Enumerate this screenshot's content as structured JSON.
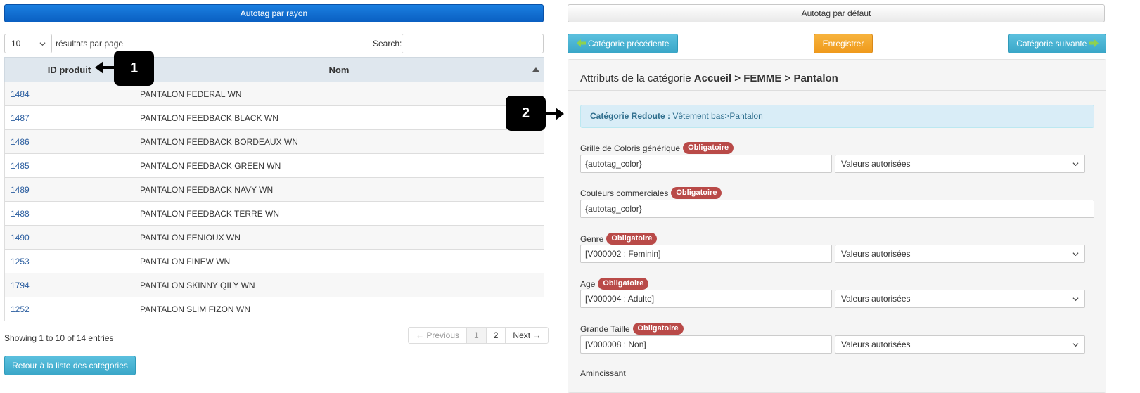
{
  "left": {
    "autotag_rayon_label": "Autotag par rayon",
    "per_page_value": "10",
    "per_page_label": "résultats par page",
    "search_label": "Search:",
    "search_value": "",
    "table": {
      "columns": [
        "ID produit",
        "Nom"
      ],
      "rows": [
        {
          "id": "1484",
          "nom": "PANTALON FEDERAL WN"
        },
        {
          "id": "1487",
          "nom": "PANTALON FEEDBACK BLACK WN"
        },
        {
          "id": "1486",
          "nom": "PANTALON FEEDBACK BORDEAUX WN"
        },
        {
          "id": "1485",
          "nom": "PANTALON FEEDBACK GREEN WN"
        },
        {
          "id": "1489",
          "nom": "PANTALON FEEDBACK NAVY WN"
        },
        {
          "id": "1488",
          "nom": "PANTALON FEEDBACK TERRE WN"
        },
        {
          "id": "1490",
          "nom": "PANTALON FENIOUX WN"
        },
        {
          "id": "1253",
          "nom": "PANTALON FINEW WN"
        },
        {
          "id": "1794",
          "nom": "PANTALON SKINNY QILY WN"
        },
        {
          "id": "1252",
          "nom": "PANTALON SLIM FIZON WN"
        }
      ]
    },
    "showing_text": "Showing 1 to 10 of 14 entries",
    "pagination": {
      "previous": "← Previous",
      "page1": "1",
      "page2": "2",
      "next": "Next →"
    },
    "retour_label": "Retour à la liste des catégories"
  },
  "right": {
    "autotag_defaut_label": "Autotag par défaut",
    "prev_category_label": "Catégorie précédente",
    "save_label": "Enregistrer",
    "next_category_label": "Catégorie suivante",
    "panel_title_prefix": "Attributs de la catégorie ",
    "panel_title_path": "Accueil > FEMME > Pantalon",
    "info_label": "Catégorie Redoute :",
    "info_value": " Vêtement bas>Pantalon",
    "badge_text": "Obligatoire",
    "allowed_values_label": "Valeurs autorisées",
    "fields": [
      {
        "label": "Grille de Coloris générique",
        "value": "{autotag_color}"
      },
      {
        "label": "Couleurs commerciales",
        "value": "{autotag_color}"
      },
      {
        "label": "Genre",
        "value": "[V000002 : Feminin]"
      },
      {
        "label": "Age",
        "value": "[V000004 : Adulte]"
      },
      {
        "label": "Grande Taille",
        "value": "[V000008 : Non]"
      },
      {
        "label": "Amincissant"
      }
    ]
  },
  "callouts": [
    "1",
    "2"
  ],
  "colors": {
    "primary": "#0a5fc2",
    "info": "#5bc0de",
    "warning": "#ef9a1c",
    "danger": "#b94a48"
  }
}
